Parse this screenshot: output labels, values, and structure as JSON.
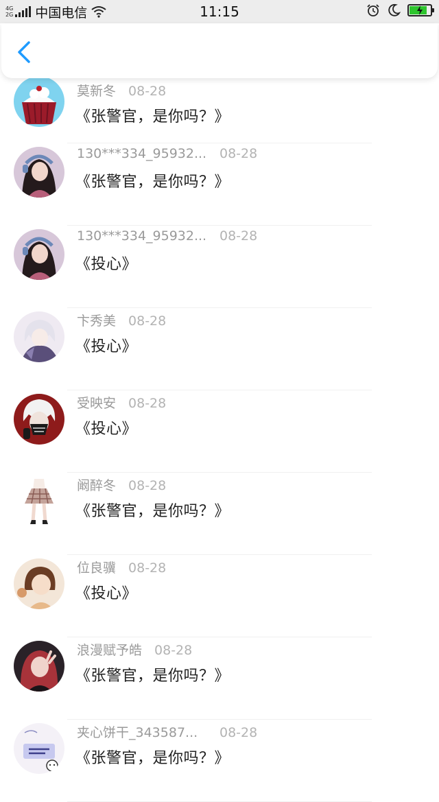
{
  "status_bar": {
    "network_top": "4G",
    "network_bottom": "2G",
    "carrier": "中国电信",
    "time": "11:15",
    "battery_level": 0.85,
    "battery_color": "#2ec52e"
  },
  "nav": {
    "back_icon": "chevron-left-icon",
    "accent": "#1e9bff"
  },
  "rows": [
    {
      "name": "莫新冬",
      "date": "08-28",
      "message": "《张警官，是你吗？》",
      "avatar": "cupcake"
    },
    {
      "name": "130***334_95932...",
      "date": "08-28",
      "message": "《张警官，是你吗？》",
      "avatar": "girl-headphones"
    },
    {
      "name": "130***334_95932...",
      "date": "08-28",
      "message": "《投心》",
      "avatar": "girl-headphones"
    },
    {
      "name": "卞秀美",
      "date": "08-28",
      "message": "《投心》",
      "avatar": "anime-white-hair"
    },
    {
      "name": "受映安",
      "date": "08-28",
      "message": "《投心》",
      "avatar": "anime-mask"
    },
    {
      "name": "阚醉冬",
      "date": "08-28",
      "message": "《张警官，是你吗？》",
      "avatar": "plaid-skirt"
    },
    {
      "name": "位良骥",
      "date": "08-28",
      "message": "《投心》",
      "avatar": "anime-brown-hair"
    },
    {
      "name": "浪漫赋予皓",
      "date": "08-28",
      "message": "《张警官，是你吗？》",
      "avatar": "girl-red-hair"
    },
    {
      "name": "夹心饼干_343587...",
      "date": "08-28",
      "message": "《张警官，是你吗？》",
      "avatar": "sticker-card"
    }
  ]
}
